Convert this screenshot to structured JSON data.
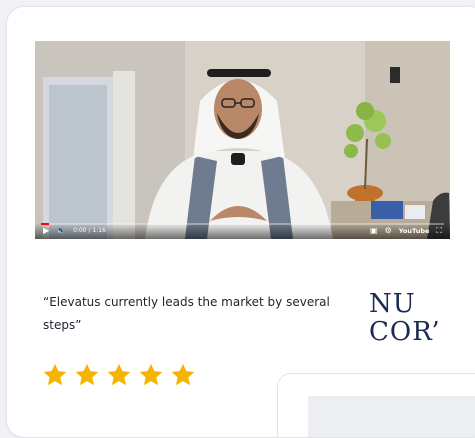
{
  "testimonial": {
    "quote": "“Elevatus currently leads the market by several steps”",
    "rating": 5,
    "rating_max": 5,
    "company_logo": {
      "line1": "NU",
      "line2": "COR’"
    }
  },
  "video": {
    "time": "0:00 / 1:16",
    "brand": "YouTube",
    "progress": 0.02
  },
  "colors": {
    "star": "#f4b400",
    "logo": "#1c2a52",
    "quote_text": "#1f2230",
    "progress": "#ff0000"
  }
}
